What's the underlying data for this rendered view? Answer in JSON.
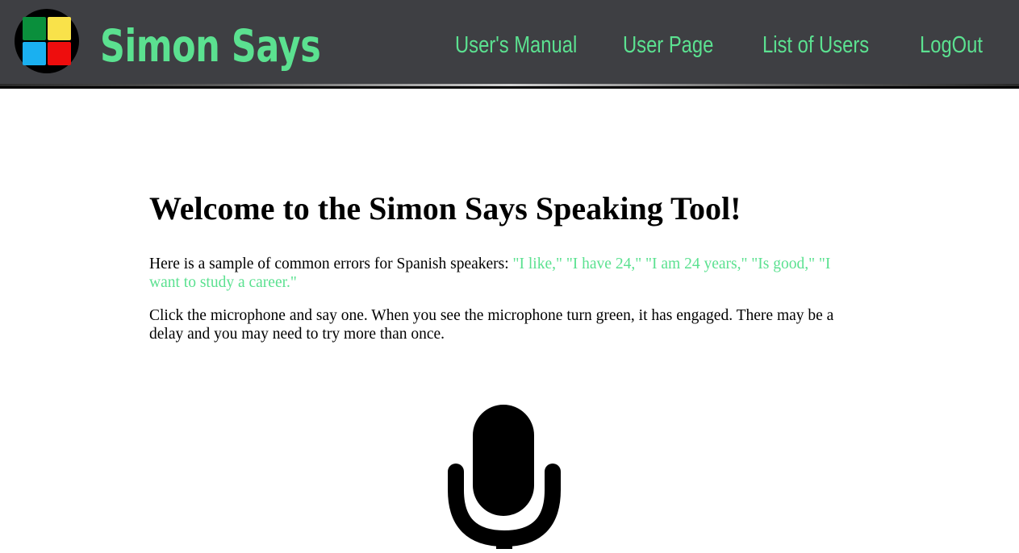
{
  "colors": {
    "navbar_bg": "#3e3f43",
    "accent_green": "#5be190",
    "logo_green": "#0a8f3c",
    "logo_yellow": "#f9e24a",
    "logo_blue": "#1ab0f0",
    "logo_red": "#ee0d0d",
    "mic_idle": "#000000"
  },
  "header": {
    "logo_icon": "four-color-squares-logo",
    "brand": "Simon Says",
    "nav": [
      {
        "label": "User's Manual"
      },
      {
        "label": "User Page"
      },
      {
        "label": "List of Users"
      },
      {
        "label": "LogOut"
      }
    ]
  },
  "main": {
    "title": "Welcome to the Simon Says Speaking Tool!",
    "intro": "Here is a sample of common errors for Spanish speakers: ",
    "examples": "\"I like,\" \"I have 24,\" \"I am 24 years,\" \"Is good,\" \"I want to study a career.\"",
    "instructions": "Click the microphone and say one. When you see the microphone turn green, it has engaged. There may be a delay and you may need to try more than once.",
    "mic_icon": "microphone-icon"
  }
}
